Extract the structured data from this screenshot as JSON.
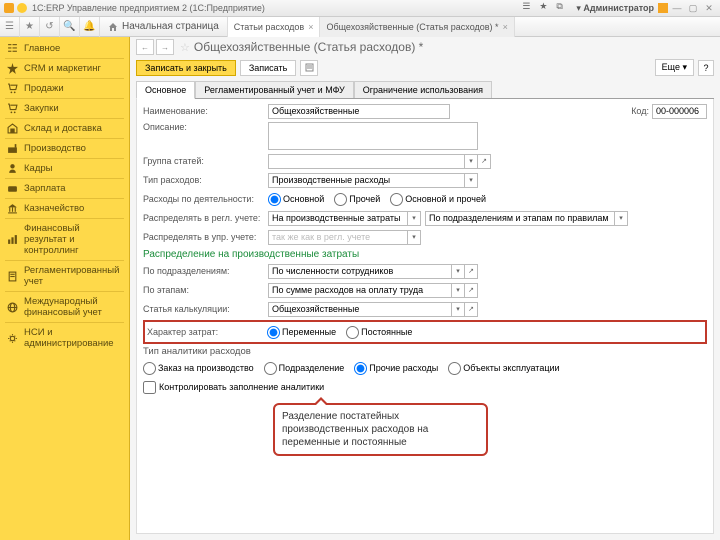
{
  "titlebar": {
    "text": "1С:ERP Управление предприятием 2  (1С:Предприятие)",
    "user": "Администратор"
  },
  "toolbar": {
    "home": "Начальная страница",
    "tabs": [
      {
        "label": "Статьи расходов",
        "active": false
      },
      {
        "label": "Общехозяйственные (Статья расходов) *",
        "active": true
      }
    ]
  },
  "sidebar": [
    {
      "key": "main",
      "label": "Главное",
      "icon": "menu"
    },
    {
      "key": "crm",
      "label": "CRM и маркетинг",
      "icon": "star"
    },
    {
      "key": "sales",
      "label": "Продажи",
      "icon": "cart"
    },
    {
      "key": "purchases",
      "label": "Закупки",
      "icon": "cart"
    },
    {
      "key": "warehouse",
      "label": "Склад и доставка",
      "icon": "warehouse"
    },
    {
      "key": "production",
      "label": "Производство",
      "icon": "factory"
    },
    {
      "key": "hr",
      "label": "Кадры",
      "icon": "people"
    },
    {
      "key": "salary",
      "label": "Зарплата",
      "icon": "wallet"
    },
    {
      "key": "treasury",
      "label": "Казначейство",
      "icon": "bank"
    },
    {
      "key": "finres",
      "label": "Финансовый результат и контроллинг",
      "icon": "chart"
    },
    {
      "key": "regacc",
      "label": "Регламентированный учет",
      "icon": "book"
    },
    {
      "key": "intlfin",
      "label": "Международный финансовый учет",
      "icon": "globe"
    },
    {
      "key": "nsi",
      "label": "НСИ и администрирование",
      "icon": "gear"
    }
  ],
  "page": {
    "title": "Общехозяйственные (Статья расходов) *"
  },
  "actions": {
    "saveClose": "Записать и закрыть",
    "save": "Записать",
    "more": "Еще",
    "help": "?"
  },
  "pageTabs": [
    {
      "label": "Основное",
      "selected": true
    },
    {
      "label": "Регламентированный учет и МФУ",
      "selected": false
    },
    {
      "label": "Ограничение использования",
      "selected": false
    }
  ],
  "form": {
    "name": {
      "label": "Наименование:",
      "value": "Общехозяйственные"
    },
    "code": {
      "label": "Код:",
      "value": "00-000006"
    },
    "description": {
      "label": "Описание:",
      "value": ""
    },
    "group": {
      "label": "Группа статей:",
      "value": ""
    },
    "type": {
      "label": "Тип расходов:",
      "value": "Производственные расходы"
    },
    "activity": {
      "label": "Расходы по деятельности:",
      "options": [
        "Основной",
        "Прочей",
        "Основной и прочей"
      ],
      "selected": "Основной"
    },
    "distReg": {
      "label": "Распределять в регл. учете:",
      "val1": "На производственные затраты",
      "val2": "По подразделениям и этапам по правилам"
    },
    "distMgmt": {
      "label": "Распределять в упр. учете:",
      "placeholder": "так же как в регл. учете"
    },
    "section1": "Распределение на производственные затраты",
    "byDept": {
      "label": "По подразделениям:",
      "value": "По численности сотрудников"
    },
    "byStage": {
      "label": "По этапам:",
      "value": "По сумме расходов на оплату труда"
    },
    "calcItem": {
      "label": "Статья калькуляции:",
      "value": "Общехозяйственные"
    },
    "costNature": {
      "label": "Характер затрат:",
      "options": [
        "Переменные",
        "Постоянные"
      ],
      "selected": "Переменные"
    },
    "section2": "Тип аналитики расходов",
    "analytics": {
      "options": [
        "Заказ на производство",
        "Подразделение",
        "Прочие расходы",
        "Объекты эксплуатации"
      ],
      "selected": "Прочие расходы"
    },
    "controlFill": "Контролировать заполнение аналитики"
  },
  "callout": "Разделение постатейных производственных расходов на переменные и постоянные"
}
